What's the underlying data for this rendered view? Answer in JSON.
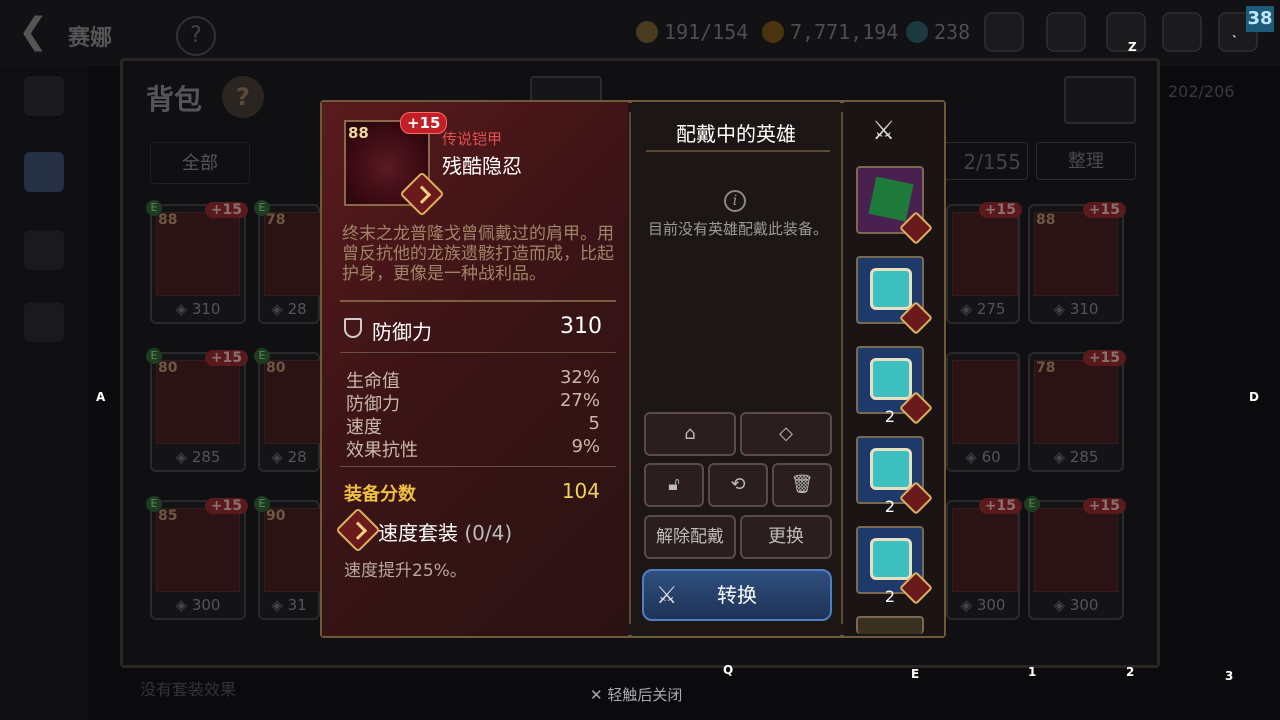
{
  "topbar": {
    "title": "赛娜",
    "help": "?",
    "resources": [
      {
        "icon": "stamina-icon",
        "value": "191/154",
        "color": "#8a6a30"
      },
      {
        "icon": "gold-icon",
        "value": "7,771,194",
        "color": "#8a6420"
      },
      {
        "icon": "crystal-icon",
        "value": "238",
        "color": "#2a5a6a"
      }
    ],
    "badge": "38"
  },
  "inventory": {
    "title": "背包",
    "help": "?",
    "filter_all": "全部",
    "count": "2/155",
    "sort_label": "整理",
    "capacity": "202/206",
    "bottom_hint": "没有套装效果",
    "cards": [
      {
        "lvl": "88",
        "plus": "+15",
        "stat": "310",
        "e": "E"
      },
      {
        "lvl": "78",
        "plus": "",
        "stat": "28",
        "e": "E"
      },
      {
        "lvl": "80",
        "plus": "+15",
        "stat": "285",
        "e": "E"
      },
      {
        "lvl": "80",
        "plus": "",
        "stat": "28",
        "e": "E"
      },
      {
        "lvl": "85",
        "plus": "+15",
        "stat": "300",
        "e": "E"
      },
      {
        "lvl": "90",
        "plus": "",
        "stat": "31",
        "e": "E"
      },
      {
        "lvl": "",
        "plus": "+15",
        "stat": "275",
        "e": ""
      },
      {
        "lvl": "88",
        "plus": "+15",
        "stat": "310",
        "e": ""
      },
      {
        "lvl": "",
        "plus": "",
        "stat": "60",
        "e": ""
      },
      {
        "lvl": "78",
        "plus": "+15",
        "stat": "285",
        "e": ""
      },
      {
        "lvl": "",
        "plus": "+15",
        "stat": "300",
        "e": ""
      },
      {
        "lvl": "",
        "plus": "+15",
        "stat": "300",
        "e": "E"
      }
    ]
  },
  "item": {
    "level": "88",
    "plus": "+15",
    "rarity": "传说铠甲",
    "name": "残酷隐忍",
    "description": "终末之龙普隆戈曾佩戴过的肩甲。用曾反抗他的龙族遗骸打造而成，比起护身，更像是一种战利品。",
    "main_stat_label": "防御力",
    "main_stat_value": "310",
    "substats": [
      {
        "label": "生命值",
        "value": "32%"
      },
      {
        "label": "防御力",
        "value": "27%"
      },
      {
        "label": "速度",
        "value": "5"
      },
      {
        "label": "效果抗性",
        "value": "9%"
      }
    ],
    "score_label": "装备分数",
    "score_value": "104",
    "set_name": "速度套装",
    "set_count": "(0/4)",
    "set_effect": "速度提升25%。"
  },
  "equipped": {
    "title": "配戴中的英雄",
    "no_hero": "目前没有英雄配戴此装备。",
    "unequip": "解除配戴",
    "replace": "更换",
    "convert": "转换"
  },
  "slots": [
    {
      "num": "",
      "color": "#1e7a3a"
    },
    {
      "num": "",
      "color": "#3fc0c0"
    },
    {
      "num": "2",
      "color": "#3fc0c0"
    },
    {
      "num": "2",
      "color": "#3fc0c0"
    },
    {
      "num": "2",
      "color": "#3fc0c0"
    }
  ],
  "close_hint": "轻触后关闭",
  "overlay_keys": {
    "z": "Z",
    "a": "A",
    "d": "D",
    "q": "Q",
    "e": "E",
    "k1": "1",
    "k2": "2",
    "k3": "3",
    "tick": "`"
  }
}
